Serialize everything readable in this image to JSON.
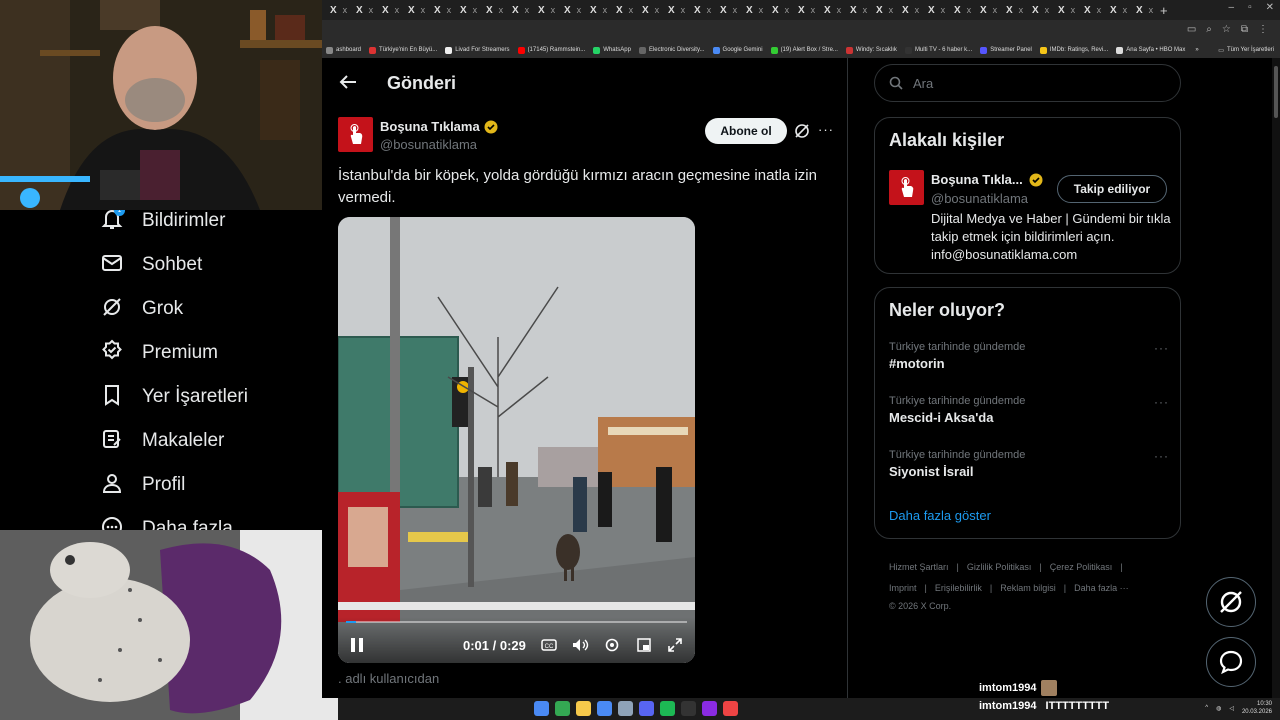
{
  "browser": {
    "tab_label": "X",
    "tab_close": "x",
    "tab_count": 32,
    "new_tab": "+",
    "bookmarks": [
      {
        "label": "ashboard",
        "color": "#888888"
      },
      {
        "label": "Türkiye'nin En Büyü...",
        "color": "#d33"
      },
      {
        "label": "Livad For Streamers",
        "color": "#eee"
      },
      {
        "label": "(17145) Rammstein...",
        "color": "#f00"
      },
      {
        "label": "WhatsApp",
        "color": "#25d366"
      },
      {
        "label": "Electronic Diversity...",
        "color": "#666"
      },
      {
        "label": "Google Gemini",
        "color": "#4a8af4"
      },
      {
        "label": "(19) Alert Box / Stre...",
        "color": "#3c3"
      },
      {
        "label": "Windy: Sıcaklık",
        "color": "#c33"
      },
      {
        "label": "Multi TV - 6 haber k...",
        "color": "#333"
      },
      {
        "label": "Streamer Panel",
        "color": "#55f"
      },
      {
        "label": "IMDb: Ratings, Revi...",
        "color": "#f5c518"
      },
      {
        "label": "Ana Sayfa • HBO Max",
        "color": "#ddd"
      }
    ],
    "bookmarks_overflow": "»",
    "bookmarks_folder": "Tüm Yer İşaretleri"
  },
  "nav": {
    "items": [
      {
        "label": "Bildirimler",
        "icon": "bell-icon"
      },
      {
        "label": "Sohbet",
        "icon": "mail-icon"
      },
      {
        "label": "Grok",
        "icon": "grok-icon"
      },
      {
        "label": "Premium",
        "icon": "premium-icon"
      },
      {
        "label": "Yer İşaretleri",
        "icon": "bookmark-icon"
      },
      {
        "label": "Makaleler",
        "icon": "article-icon"
      },
      {
        "label": "Profil",
        "icon": "profile-icon"
      },
      {
        "label": "Daha fazla",
        "icon": "more-icon"
      }
    ],
    "notification_badge": "1"
  },
  "post": {
    "page_title": "Gönderi",
    "author_name": "Boşuna Tıklama",
    "author_handle": "@bosunatiklama",
    "subscribe_label": "Abone ol",
    "more": "···",
    "text": "İstanbul'da bir köpek, yolda gördüğü kırmızı aracın geçmesine inatla izin vermedi.",
    "video_time": "0:01 / 0:29",
    "video_progress": 0.03,
    "username_hint": ". adlı kullanıcıdan"
  },
  "sidebar": {
    "search_placeholder": "Ara",
    "related_title": "Alakalı kişiler",
    "related_name": "Boşuna Tıkla...",
    "related_handle": "@bosunatiklama",
    "follow_label": "Takip ediliyor",
    "related_bio": "Dijital Medya ve Haber | Gündemi bir tıkla takip etmek için bildirimleri açın. info@bosunatiklama.com",
    "trends_title": "Neler oluyor?",
    "trends": [
      {
        "context": "Türkiye tarihinde gündemde",
        "name": "#motorin"
      },
      {
        "context": "Türkiye tarihinde gündemde",
        "name": "Mescid-i Aksa'da"
      },
      {
        "context": "Türkiye tarihinde gündemde",
        "name": "Siyonist İsrail"
      }
    ],
    "trend_more": "···",
    "show_more": "Daha fazla göster",
    "footer": {
      "links_row1": [
        "Hizmet Şartları",
        "Gizlilik Politikası",
        "Çerez Politikası"
      ],
      "links_row2": [
        "Imprint",
        "Erişilebilirlik",
        "Reklam bilgisi",
        "Daha fazla ···"
      ],
      "copyright": "© 2026 X Corp."
    }
  },
  "chat": {
    "msg1_user": "imtom1994",
    "msg2_user": "imtom1994",
    "msg2_text": "ITTTTTTTTT"
  },
  "taskbar": {
    "time": "10:30",
    "date": "20.03.2026",
    "tray_arrow": "^"
  },
  "colors": {
    "accent": "#1d9bf0",
    "brand_red": "#c4121a",
    "verified_gold": "#e2b719"
  }
}
